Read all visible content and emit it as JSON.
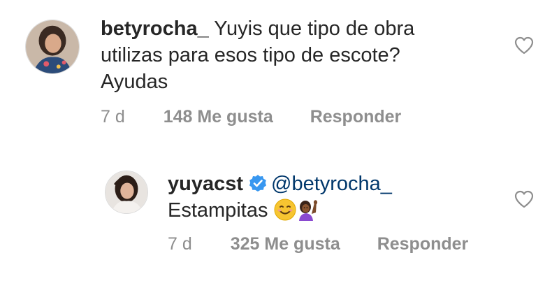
{
  "comments": [
    {
      "username": "betyrocha_",
      "text": "Yuyis que tipo de obra utilizas para esos tipo de escote? Ayudas",
      "time": "7 d",
      "likes": "148 Me gusta",
      "reply_label": "Responder"
    }
  ],
  "reply": {
    "username": "yuyacst",
    "mention": "@betyrocha_",
    "text": "Estampitas",
    "emojis": [
      "smiling-face-icon",
      "person-raising-hand-icon"
    ],
    "time": "7 d",
    "likes": "325 Me gusta",
    "reply_label": "Responder"
  },
  "colors": {
    "text": "#262626",
    "meta": "#8e8e8e",
    "mention": "#00376b",
    "verified": "#3897f0"
  }
}
